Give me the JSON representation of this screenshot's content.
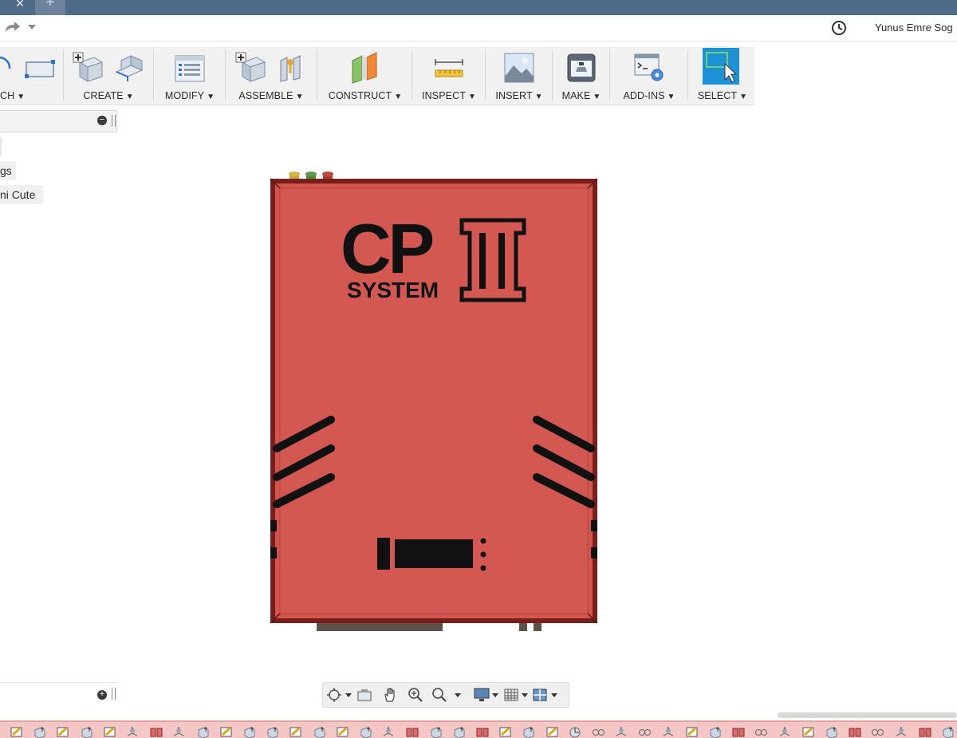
{
  "tabs": {
    "close_glyph": "×",
    "new_glyph": "+"
  },
  "header": {
    "user_name": "Yunus Emre Sog"
  },
  "toolbar": {
    "groups": [
      {
        "id": "sketch",
        "label": "CH"
      },
      {
        "id": "create",
        "label": "CREATE"
      },
      {
        "id": "modify",
        "label": "MODIFY"
      },
      {
        "id": "assemble",
        "label": "ASSEMBLE"
      },
      {
        "id": "construct",
        "label": "CONSTRUCT"
      },
      {
        "id": "inspect",
        "label": "INSPECT"
      },
      {
        "id": "insert",
        "label": "INSERT"
      },
      {
        "id": "make",
        "label": "MAKE"
      },
      {
        "id": "addins",
        "label": "ADD-INS"
      },
      {
        "id": "select",
        "label": "SELECT"
      }
    ],
    "dropdown_glyph": "▼"
  },
  "browser": {
    "nodes": [
      {
        "label": ""
      },
      {
        "label": "gs"
      },
      {
        "label": "ni Cute"
      }
    ]
  },
  "model": {
    "logo_text_main": "CP",
    "logo_text_sub": "SYSTEM",
    "logo_numeral": "II",
    "body_color": "#d1544e",
    "frame_color": "#7a1e1b",
    "connector_colors": [
      "#c8a23a",
      "#4f8a3a",
      "#a93b34"
    ]
  },
  "colors": {
    "tab_bar": "#506b87",
    "ribbon": "#f1f1f1",
    "select_active": "#1e90d6",
    "timeline": "#f4c6c6"
  },
  "timeline": {
    "items": [
      "sketch",
      "body",
      "sketch",
      "body",
      "sketch",
      "joint",
      "component",
      "joint",
      "body",
      "sketch",
      "body",
      "body",
      "sketch",
      "body",
      "sketch",
      "body",
      "joint",
      "component",
      "body",
      "body",
      "component",
      "sketch",
      "body",
      "sketch",
      "revolve",
      "constraint",
      "joint",
      "constraint",
      "joint",
      "sketch",
      "body",
      "component",
      "constraint",
      "joint",
      "sketch",
      "body",
      "component",
      "constraint",
      "joint",
      "component",
      "body",
      "component"
    ]
  }
}
